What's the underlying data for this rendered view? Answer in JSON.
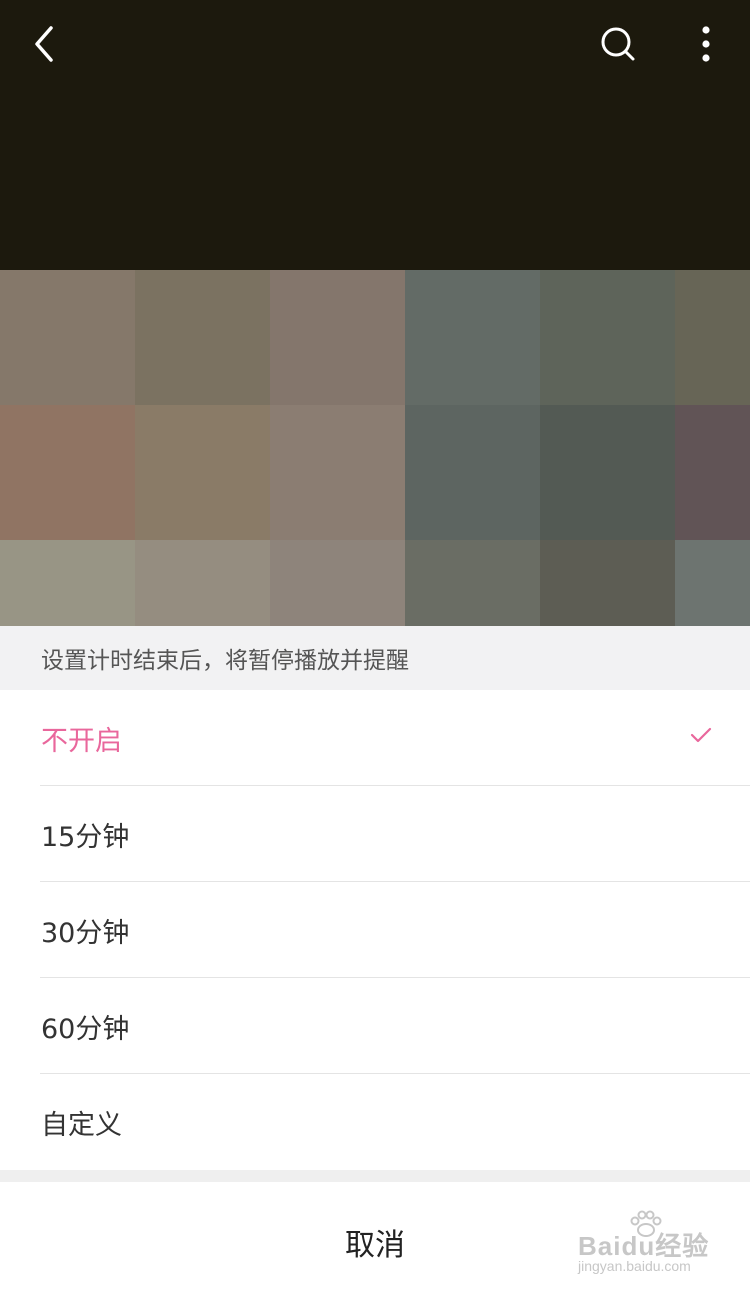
{
  "sleep_timer": {
    "notice": "设置计时结束后，将暂停播放并提醒",
    "options": [
      {
        "label": "不开启",
        "selected": true
      },
      {
        "label": "15分钟",
        "selected": false
      },
      {
        "label": "30分钟",
        "selected": false
      },
      {
        "label": "60分钟",
        "selected": false
      },
      {
        "label": "自定义",
        "selected": false
      }
    ],
    "cancel_label": "取消"
  },
  "icons": {
    "back": "back-arrow-icon",
    "search": "search-icon",
    "more": "more-vertical-icon",
    "check": "checkmark-icon"
  },
  "colors": {
    "accent": "#e9679c",
    "header_background": "#1c190d",
    "sheet_header_background": "#f2f2f3"
  },
  "watermark": {
    "brand": "Baidu经验",
    "url": "jingyan.baidu.com"
  }
}
